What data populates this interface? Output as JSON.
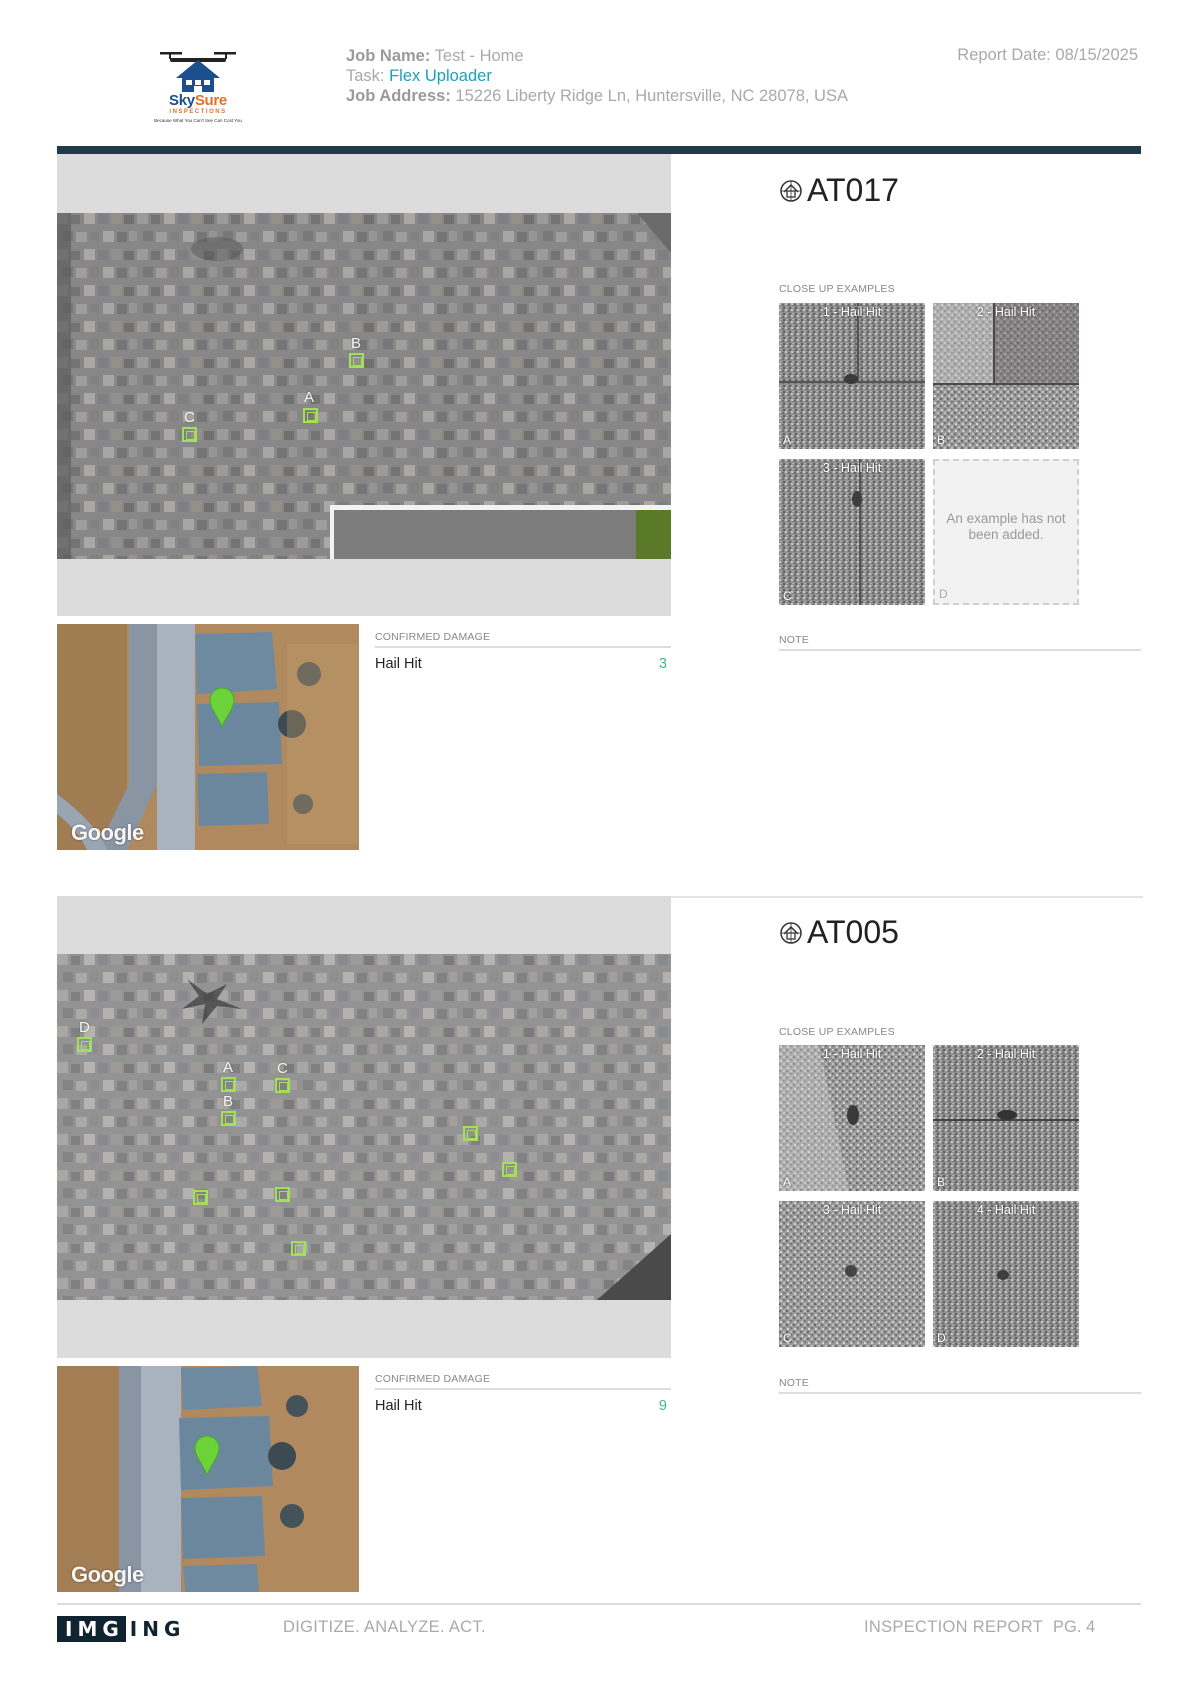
{
  "header": {
    "logo": {
      "brand_part1": "Sky",
      "brand_part2": "Sure",
      "subtitle": "INSPECTIONS",
      "tagline": "Because What You Can't See Can Cost You",
      "icon": "drone-house-icon"
    },
    "job_name_label": "Job Name:",
    "job_name_value": " Test - Home",
    "task_label": "Task:",
    "task_value": " Flex Uploader",
    "job_address_label": "Job Address:",
    "job_address_value": " 15226 Liberty Ridge Ln, Huntersville, NC 28078, USA",
    "report_date": "Report Date: 08/15/2025"
  },
  "sections": [
    {
      "tag": "AT017",
      "tag_icon": "roof-target-icon",
      "markers": [
        "A",
        "B",
        "C"
      ],
      "map_watermark": "Google",
      "confirmed_damage_heading": "CONFIRMED DAMAGE",
      "damage": [
        {
          "type": "Hail Hit",
          "count": "3"
        }
      ],
      "closeups_heading": "CLOSE UP EXAMPLES",
      "closeups": [
        {
          "title": "1 - Hail Hit",
          "letter": "A"
        },
        {
          "title": "2 - Hail Hit",
          "letter": "B"
        },
        {
          "title": "3 - Hail Hit",
          "letter": "C"
        },
        {
          "title": "",
          "letter": "D",
          "empty_text": "An example has not been added."
        }
      ],
      "note_heading": "NOTE"
    },
    {
      "tag": "AT005",
      "tag_icon": "roof-target-icon",
      "markers": [
        "D",
        "A",
        "C",
        "B"
      ],
      "map_watermark": "Google",
      "confirmed_damage_heading": "CONFIRMED DAMAGE",
      "damage": [
        {
          "type": "Hail Hit",
          "count": "9"
        }
      ],
      "closeups_heading": "CLOSE UP EXAMPLES",
      "closeups": [
        {
          "title": "1 - Hail Hit",
          "letter": "A"
        },
        {
          "title": "2 - Hail Hit",
          "letter": "B"
        },
        {
          "title": "3 - Hail Hit",
          "letter": "C"
        },
        {
          "title": "4 - Hail Hit",
          "letter": "D"
        }
      ],
      "note_heading": "NOTE"
    }
  ],
  "footer": {
    "logo_part1": "IMG",
    "logo_part2": "ING",
    "tagline": "DIGITIZE. ANALYZE. ACT.",
    "report_label": "INSPECTION REPORT",
    "page": "PG. 4"
  }
}
